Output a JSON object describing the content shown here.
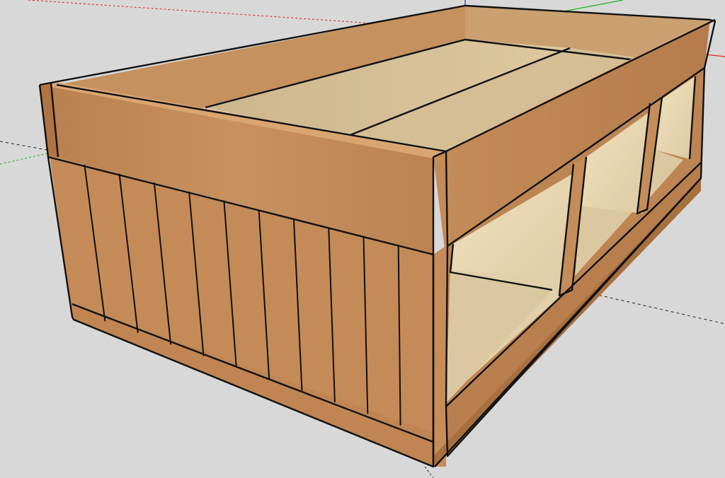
{
  "scene": {
    "background_color": "#d8d8d8",
    "model": "bed-frame-with-storage-cubbies",
    "colors": {
      "wood_front": "#c08a58",
      "wood_side": "#b98150",
      "wood_top_edge": "#d3a06b",
      "wood_inner": "#c79563",
      "plywood_light": "#e7d7b2",
      "plywood_shadow": "#cdbd98",
      "deck": "#d9c39a",
      "axis_red": "#e02020",
      "axis_green": "#20b020",
      "axis_blue": "#2030d0",
      "inference_black": "#222222"
    },
    "vertical_slat_count": 11,
    "storage_cubby_count": 3
  }
}
